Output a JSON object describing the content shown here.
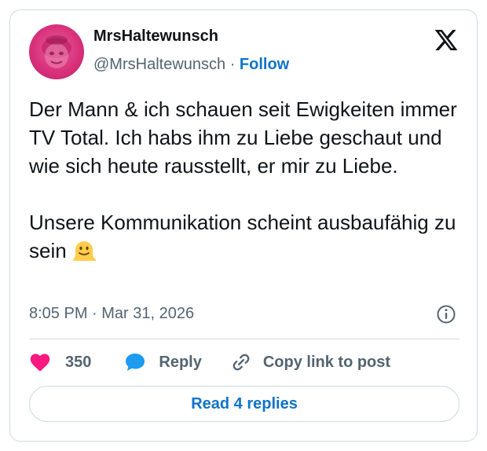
{
  "author": {
    "display_name": "MrsHaltewunsch",
    "handle": "@MrsHaltewunsch",
    "separator": "·",
    "follow_label": "Follow",
    "avatar_color": "#d9327c"
  },
  "post": {
    "paragraph1": "Der Mann & ich schauen seit Ewigkeiten immer TV Total. Ich habs ihm zu Liebe geschaut und wie sich heute rausstellt, er mir zu Liebe.",
    "paragraph2": "Unsere Kommunikation scheint ausbaufähig zu sein",
    "emoji": "melting-face",
    "timestamp": "8:05 PM · Mar 31, 2026"
  },
  "actions": {
    "like_count": "350",
    "reply_label": "Reply",
    "copy_label": "Copy link to post"
  },
  "read_replies_label": "Read 4 replies",
  "colors": {
    "accent": "#0f73c9",
    "like": "#f91880",
    "reply_icon": "#1d9bf0",
    "secondary_text": "#536471",
    "border": "#cfd9de"
  },
  "icons": [
    "x-logo-icon",
    "info-icon",
    "heart-icon",
    "reply-bubble-icon",
    "link-icon",
    "melting-face-emoji"
  ]
}
